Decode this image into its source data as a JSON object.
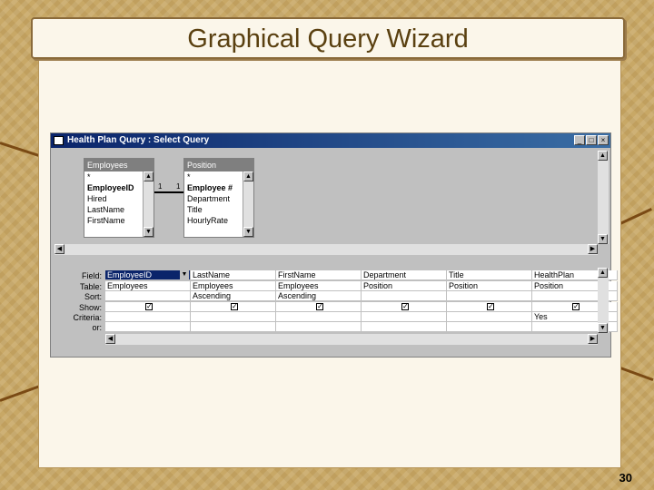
{
  "slide": {
    "title": "Graphical Query Wizard",
    "page_number": "30"
  },
  "window": {
    "title": "Health Plan Query : Select Query",
    "buttons": {
      "minimize": "_",
      "maximize": "□",
      "close": "×"
    }
  },
  "tables": [
    {
      "name": "Employees",
      "fields": [
        "*",
        "EmployeeID",
        "Hired",
        "LastName",
        "FirstName"
      ],
      "key_field": "EmployeeID"
    },
    {
      "name": "Position",
      "fields": [
        "*",
        "Employee #",
        "Department",
        "Title",
        "HourlyRate"
      ],
      "key_field": "Employee #"
    }
  ],
  "relationship": {
    "left_label": "1",
    "right_label": "1"
  },
  "grid": {
    "row_labels": [
      "Field:",
      "Table:",
      "Sort:",
      "Show:",
      "Criteria:",
      "or:"
    ],
    "columns": [
      {
        "field": "EmployeeID",
        "table": "Employees",
        "sort": "",
        "show": true,
        "criteria": ""
      },
      {
        "field": "LastName",
        "table": "Employees",
        "sort": "Ascending",
        "show": true,
        "criteria": ""
      },
      {
        "field": "FirstName",
        "table": "Employees",
        "sort": "Ascending",
        "show": true,
        "criteria": ""
      },
      {
        "field": "Department",
        "table": "Position",
        "sort": "",
        "show": true,
        "criteria": ""
      },
      {
        "field": "Title",
        "table": "Position",
        "sort": "",
        "show": true,
        "criteria": ""
      },
      {
        "field": "HealthPlan",
        "table": "Position",
        "sort": "",
        "show": true,
        "criteria": "Yes"
      }
    ],
    "selected_column": 0
  },
  "colors": {
    "titlebar": "#0a246a",
    "accent": "#7a4a14",
    "panel": "#fbf6ea"
  }
}
